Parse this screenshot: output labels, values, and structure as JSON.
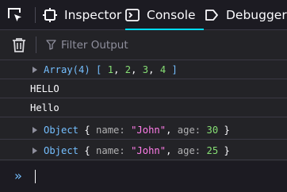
{
  "toolbar": {
    "tabs": [
      {
        "label": "Inspector"
      },
      {
        "label": "Console"
      },
      {
        "label": "Debugger"
      }
    ],
    "accent": "#00ddff"
  },
  "filter": {
    "placeholder": "Filter Output"
  },
  "messages": [
    {
      "kind": "array",
      "prefix": "Array(4)",
      "open": "[",
      "items": [
        "1",
        "2",
        "3",
        "4"
      ],
      "close": "]"
    },
    {
      "kind": "text",
      "text": "HELLO"
    },
    {
      "kind": "text",
      "text": "Hello"
    },
    {
      "kind": "object",
      "prefix": "Object",
      "name_key": "name:",
      "name_val": "\"John\"",
      "age_key": "age:",
      "age_val": "30"
    },
    {
      "kind": "object",
      "prefix": "Object",
      "name_key": "name:",
      "name_val": "\"John\"",
      "age_key": "age:",
      "age_val": "25"
    }
  ],
  "input": {
    "prompt": "»"
  }
}
